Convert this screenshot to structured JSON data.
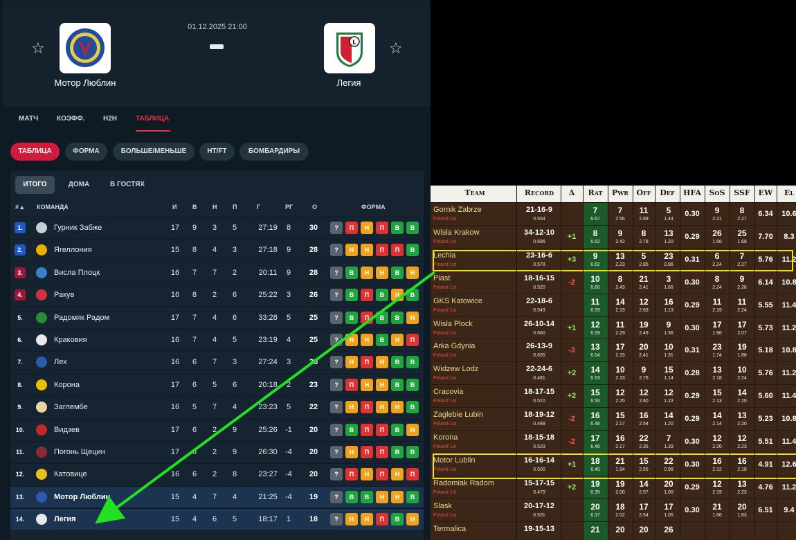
{
  "match": {
    "datetime": "01.12.2025 21:00",
    "home": "Мотор Люблин",
    "away": "Легия"
  },
  "tabs": [
    "МАТЧ",
    "КОЭФФ.",
    "H2H",
    "ТАБЛИЦА"
  ],
  "pills": [
    "ТАБЛИЦА",
    "ФОРМА",
    "БОЛЬШЕ/МЕНЬШЕ",
    "HT/FT",
    "БОМБАРДИРЫ"
  ],
  "subtabs": [
    "ИТОГО",
    "ДОМА",
    "В ГОСТЯХ"
  ],
  "columns": {
    "rank": "#",
    "team": "КОМАНДА",
    "p": "И",
    "w": "В",
    "d": "Н",
    "l": "П",
    "goals": "Г",
    "gd": "РГ",
    "pts": "О",
    "form": "ФОРМА"
  },
  "colors": {
    "accent": "#e8304a",
    "win": "#20a43e",
    "draw": "#f0a21a",
    "loss": "#df3232",
    "unknown": "#59646d"
  },
  "standings": [
    {
      "rank": "1.",
      "team": "Гурник Забже",
      "p": "17",
      "w": "9",
      "d": "3",
      "l": "5",
      "goals": "27:19",
      "gd": "8",
      "pts": "30",
      "form": [
        "?",
        "П",
        "Н",
        "П",
        "В",
        "В"
      ],
      "rank_color": "#1e58c8",
      "crest": "#c8ced6"
    },
    {
      "rank": "2.",
      "team": "Ягеллония",
      "p": "15",
      "w": "8",
      "d": "4",
      "l": "3",
      "goals": "27:18",
      "gd": "9",
      "pts": "28",
      "form": [
        "?",
        "Н",
        "Н",
        "П",
        "П",
        "В"
      ],
      "rank_color": "#1e58c8",
      "crest": "#e8b000"
    },
    {
      "rank": "3.",
      "team": "Висла Плоцк",
      "p": "16",
      "w": "7",
      "d": "7",
      "l": "2",
      "goals": "20:11",
      "gd": "9",
      "pts": "28",
      "form": [
        "?",
        "В",
        "Н",
        "Н",
        "В",
        "Н"
      ],
      "rank_color": "#a0163a",
      "crest": "#3a7fd0"
    },
    {
      "rank": "4.",
      "team": "Ракув",
      "p": "16",
      "w": "8",
      "d": "2",
      "l": "6",
      "goals": "25:22",
      "gd": "3",
      "pts": "26",
      "form": [
        "?",
        "В",
        "П",
        "В",
        "Н",
        "В"
      ],
      "rank_color": "#a0163a",
      "crest": "#d03040"
    },
    {
      "rank": "5.",
      "team": "Радомяк Радом",
      "p": "17",
      "w": "7",
      "d": "4",
      "l": "6",
      "goals": "33:28",
      "gd": "5",
      "pts": "25",
      "form": [
        "?",
        "В",
        "П",
        "В",
        "В",
        "Н"
      ],
      "rank_color": "",
      "crest": "#2a8a3a"
    },
    {
      "rank": "6.",
      "team": "Краковия",
      "p": "16",
      "w": "7",
      "d": "4",
      "l": "5",
      "goals": "23:19",
      "gd": "4",
      "pts": "25",
      "form": [
        "?",
        "Н",
        "Н",
        "В",
        "Н",
        "П"
      ],
      "rank_color": "",
      "crest": "#e8e8e8"
    },
    {
      "rank": "7.",
      "team": "Лех",
      "p": "16",
      "w": "6",
      "d": "7",
      "l": "3",
      "goals": "27:24",
      "gd": "3",
      "pts": "25",
      "form": [
        "?",
        "Н",
        "П",
        "Н",
        "В",
        "В"
      ],
      "rank_color": "",
      "crest": "#2a5ab0"
    },
    {
      "rank": "8.",
      "team": "Корона",
      "p": "17",
      "w": "6",
      "d": "5",
      "l": "6",
      "goals": "20:18",
      "gd": "2",
      "pts": "23",
      "form": [
        "?",
        "П",
        "Н",
        "Н",
        "В",
        "В"
      ],
      "rank_color": "",
      "crest": "#e8c000"
    },
    {
      "rank": "9.",
      "team": "Заглембе",
      "p": "16",
      "w": "5",
      "d": "7",
      "l": "4",
      "goals": "23:23",
      "gd": "5",
      "pts": "22",
      "form": [
        "?",
        "Н",
        "П",
        "Н",
        "Н",
        "В"
      ],
      "rank_color": "",
      "crest": "#e8d8a0"
    },
    {
      "rank": "10.",
      "team": "Видзев",
      "p": "17",
      "w": "6",
      "d": "2",
      "l": "9",
      "goals": "25:26",
      "gd": "-1",
      "pts": "20",
      "form": [
        "?",
        "В",
        "П",
        "П",
        "В",
        "Н"
      ],
      "rank_color": "",
      "crest": "#c02a2a"
    },
    {
      "rank": "11.",
      "team": "Погонь Щецин",
      "p": "17",
      "w": "6",
      "d": "2",
      "l": "9",
      "goals": "26:30",
      "gd": "-4",
      "pts": "20",
      "form": [
        "?",
        "Н",
        "П",
        "П",
        "В",
        "В"
      ],
      "rank_color": "",
      "crest": "#8a2a3a"
    },
    {
      "rank": "12.",
      "team": "Катовице",
      "p": "16",
      "w": "6",
      "d": "2",
      "l": "8",
      "goals": "23:27",
      "gd": "-4",
      "pts": "20",
      "form": [
        "?",
        "П",
        "Н",
        "П",
        "Н",
        "П"
      ],
      "rank_color": "",
      "crest": "#e8c020"
    },
    {
      "rank": "13.",
      "team": "Мотор Люблин",
      "p": "15",
      "w": "4",
      "d": "7",
      "l": "4",
      "goals": "21:25",
      "gd": "-4",
      "pts": "19",
      "form": [
        "?",
        "В",
        "В",
        "Н",
        "Н",
        "В"
      ],
      "rank_color": "",
      "crest": "#2a5ab0"
    },
    {
      "rank": "14.",
      "team": "Легия",
      "p": "15",
      "w": "4",
      "d": "6",
      "l": "5",
      "goals": "18:17",
      "gd": "1",
      "pts": "18",
      "form": [
        "?",
        "Н",
        "Н",
        "П",
        "В",
        "Н"
      ],
      "rank_color": "",
      "crest": "#e8e8e8"
    }
  ],
  "ratings": {
    "headers": [
      "Team",
      "Record",
      "Δ",
      "Rat",
      "Pwr",
      "Off",
      "Def",
      "HFA",
      "SoS",
      "SSF",
      "EW",
      "El"
    ],
    "rows": [
      {
        "team": "Gornik Zabrze",
        "league": "Poland 1st",
        "record": "21-16-9",
        "rec_sub": "0.554",
        "delta": "",
        "rat": "7",
        "rat_sub": "6.67",
        "pwr": "7",
        "pwr_sub": "2.56",
        "off": "11",
        "off_sub": "2.69",
        "def": "5",
        "def_sub": "1.44",
        "hfa": "0.30",
        "sos": "9",
        "sos_sub": "2.21",
        "ssf": "8",
        "ssf_sub": "2.27",
        "ew": "6.34",
        "el": "10.6"
      },
      {
        "team": "Wisla Krakow",
        "league": "Poland 1st",
        "record": "34-12-10",
        "rec_sub": "0.696",
        "delta": "+1",
        "rat": "8",
        "rat_sub": "6.62",
        "pwr": "9",
        "pwr_sub": "2.42",
        "off": "8",
        "off_sub": "2.78",
        "def": "13",
        "def_sub": "1.20",
        "hfa": "0.29",
        "sos": "26",
        "sos_sub": "1.66",
        "ssf": "25",
        "ssf_sub": "1.68",
        "ew": "7.70",
        "el": "8.3"
      },
      {
        "team": "Lechia",
        "league": "Poland 1st",
        "record": "23-16-6",
        "rec_sub": "0.578",
        "delta": "+3",
        "rat": "9",
        "rat_sub": "6.62",
        "pwr": "13",
        "pwr_sub": "2.23",
        "off": "5",
        "off_sub": "2.85",
        "def": "23",
        "def_sub": "0.96",
        "hfa": "0.31",
        "sos": "6",
        "sos_sub": "2.24",
        "ssf": "7",
        "ssf_sub": "2.27",
        "ew": "5.76",
        "el": "11.2"
      },
      {
        "team": "Piast",
        "league": "Poland 1st",
        "record": "18-16-15",
        "rec_sub": "0.520",
        "delta": "-2",
        "rat": "10",
        "rat_sub": "6.60",
        "pwr": "8",
        "pwr_sub": "2.43",
        "off": "21",
        "off_sub": "2.41",
        "def": "3",
        "def_sub": "1.60",
        "hfa": "0.30",
        "sos": "8",
        "sos_sub": "2.24",
        "ssf": "9",
        "ssf_sub": "2.26",
        "ew": "6.14",
        "el": "10.8"
      },
      {
        "team": "GKS Katowice",
        "league": "Poland 1st",
        "record": "22-18-6",
        "rec_sub": "0.543",
        "delta": "",
        "rat": "11",
        "rat_sub": "6.59",
        "pwr": "14",
        "pwr_sub": "2.19",
        "off": "12",
        "off_sub": "2.63",
        "def": "16",
        "def_sub": "1.13",
        "hfa": "0.29",
        "sos": "11",
        "sos_sub": "2.19",
        "ssf": "11",
        "ssf_sub": "2.24",
        "ew": "5.55",
        "el": "11.4"
      },
      {
        "team": "Wisla Plock",
        "league": "Poland 1st",
        "record": "26-10-14",
        "rec_sub": "0.660",
        "delta": "+1",
        "rat": "12",
        "rat_sub": "6.59",
        "pwr": "11",
        "pwr_sub": "2.29",
        "off": "19",
        "off_sub": "2.49",
        "def": "9",
        "def_sub": "1.36",
        "hfa": "0.30",
        "sos": "17",
        "sos_sub": "1.96",
        "ssf": "17",
        "ssf_sub": "2.07",
        "ew": "5.73",
        "el": "11.2"
      },
      {
        "team": "Arka Gdynia",
        "league": "Poland 1st",
        "record": "26-13-9",
        "rec_sub": "0.635",
        "delta": "-3",
        "rat": "13",
        "rat_sub": "6.54",
        "pwr": "17",
        "pwr_sub": "2.15",
        "off": "20",
        "off_sub": "2.41",
        "def": "10",
        "def_sub": "1.31",
        "hfa": "0.31",
        "sos": "23",
        "sos_sub": "1.74",
        "ssf": "19",
        "ssf_sub": "1.88",
        "ew": "5.18",
        "el": "10.8"
      },
      {
        "team": "Widzew Lodz",
        "league": "Poland 1st",
        "record": "22-24-6",
        "rec_sub": "0.481",
        "delta": "+2",
        "rat": "14",
        "rat_sub": "6.53",
        "pwr": "10",
        "pwr_sub": "2.33",
        "off": "9",
        "off_sub": "2.76",
        "def": "15",
        "def_sub": "1.14",
        "hfa": "0.28",
        "sos": "13",
        "sos_sub": "2.18",
        "ssf": "10",
        "ssf_sub": "2.24",
        "ew": "5.76",
        "el": "11.2"
      },
      {
        "team": "Cracovia",
        "league": "Poland 1st",
        "record": "18-17-15",
        "rec_sub": "0.510",
        "delta": "+2",
        "rat": "15",
        "rat_sub": "6.50",
        "pwr": "12",
        "pwr_sub": "2.25",
        "off": "12",
        "off_sub": "2.60",
        "def": "12",
        "def_sub": "1.22",
        "hfa": "0.29",
        "sos": "15",
        "sos_sub": "2.13",
        "ssf": "14",
        "ssf_sub": "2.20",
        "ew": "5.60",
        "el": "11.4"
      },
      {
        "team": "Zaglebie Lubin",
        "league": "Poland 1st",
        "record": "18-19-12",
        "rec_sub": "0.489",
        "delta": "-2",
        "rat": "16",
        "rat_sub": "6.48",
        "pwr": "15",
        "pwr_sub": "2.17",
        "off": "16",
        "off_sub": "2.54",
        "def": "14",
        "def_sub": "1.20",
        "hfa": "0.29",
        "sos": "14",
        "sos_sub": "2.14",
        "ssf": "13",
        "ssf_sub": "2.20",
        "ew": "5.23",
        "el": "10.8"
      },
      {
        "team": "Korona",
        "league": "Poland 1st",
        "record": "18-15-18",
        "rec_sub": "0.529",
        "delta": "-2",
        "rat": "17",
        "rat_sub": "6.46",
        "pwr": "16",
        "pwr_sub": "2.17",
        "off": "22",
        "off_sub": "2.35",
        "def": "7",
        "def_sub": "1.39",
        "hfa": "0.30",
        "sos": "12",
        "sos_sub": "2.20",
        "ssf": "12",
        "ssf_sub": "2.23",
        "ew": "5.51",
        "el": "11.4"
      },
      {
        "team": "Motor Lublin",
        "league": "Poland 1st",
        "record": "16-16-14",
        "rec_sub": "0.500",
        "delta": "+1",
        "rat": "18",
        "rat_sub": "6.40",
        "pwr": "21",
        "pwr_sub": "1.94",
        "off": "15",
        "off_sub": "2.55",
        "def": "22",
        "def_sub": "0.96",
        "hfa": "0.30",
        "sos": "16",
        "sos_sub": "2.12",
        "ssf": "16",
        "ssf_sub": "2.18",
        "ew": "4.91",
        "el": "12.6"
      },
      {
        "team": "Radomiak Radom",
        "league": "Poland 1st",
        "record": "15-17-15",
        "rec_sub": "0.479",
        "delta": "+2",
        "rat": "19",
        "rat_sub": "6.39",
        "pwr": "19",
        "pwr_sub": "2.00",
        "off": "14",
        "off_sub": "2.57",
        "def": "20",
        "def_sub": "1.00",
        "hfa": "0.29",
        "sos": "12",
        "sos_sub": "2.19",
        "ssf": "13",
        "ssf_sub": "2.23",
        "ew": "4.76",
        "el": "11.2"
      },
      {
        "team": "Slask",
        "league": "Poland 1st",
        "record": "20-17-12",
        "rec_sub": "0.531",
        "delta": "",
        "rat": "20",
        "rat_sub": "6.37",
        "pwr": "18",
        "pwr_sub": "2.02",
        "off": "17",
        "off_sub": "2.54",
        "def": "17",
        "def_sub": "1.05",
        "hfa": "0.30",
        "sos": "21",
        "sos_sub": "1.86",
        "ssf": "20",
        "ssf_sub": "1.83",
        "ew": "6.51",
        "el": "9.4"
      },
      {
        "team": "Termalica",
        "league": "",
        "record": "19-15-13",
        "rec_sub": "",
        "delta": "",
        "rat": "21",
        "rat_sub": "",
        "pwr": "20",
        "pwr_sub": "",
        "off": "20",
        "off_sub": "",
        "def": "26",
        "def_sub": "",
        "hfa": "",
        "sos": "",
        "sos_sub": "",
        "ssf": "",
        "ssf_sub": "",
        "ew": "",
        "el": ""
      }
    ]
  }
}
